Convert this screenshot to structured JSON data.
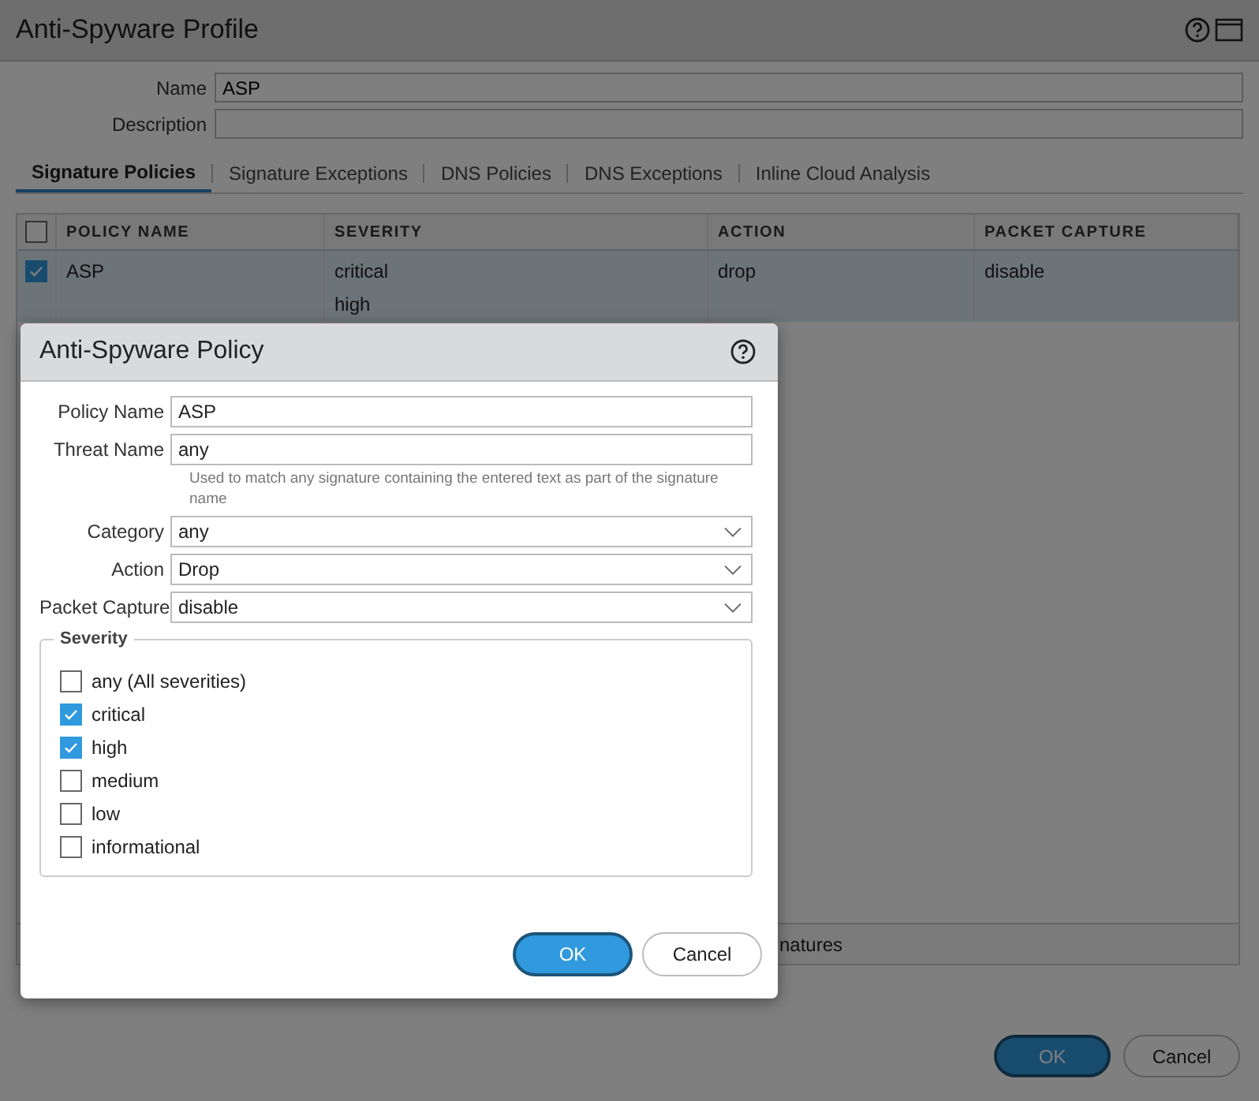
{
  "profile": {
    "title": "Anti-Spyware Profile",
    "fields": [
      {
        "label": "Name",
        "value": "ASP"
      },
      {
        "label": "Description"
      }
    ],
    "tabs": [
      {
        "label": "Signature Policies",
        "selected": true
      },
      {
        "label": "Signature Exceptions",
        "selected": false
      },
      {
        "label": "DNS Policies",
        "selected": false
      },
      {
        "label": "DNS Exceptions",
        "selected": false
      },
      {
        "label": "Inline Cloud Analysis",
        "selected": false
      }
    ],
    "table": {
      "header_checked": false,
      "columns": [
        "POLICY NAME",
        "SEVERITY",
        "ACTION",
        "PACKET CAPTURE"
      ],
      "rows": [
        {
          "checked": true,
          "selected": true,
          "policy_name": "ASP",
          "severity": [
            "critical",
            "high"
          ],
          "action": "drop",
          "packet_capture": "disable"
        }
      ]
    },
    "toolbar_text": "natures",
    "buttons": [
      {
        "label": "OK",
        "kind": "primary"
      },
      {
        "label": "Cancel",
        "kind": "secondary"
      }
    ]
  },
  "dialog": {
    "title": "Anti-Spyware Policy",
    "fields": [
      {
        "label": "Policy Name",
        "kind": "text",
        "value": "ASP"
      },
      {
        "label": "Threat Name",
        "kind": "text",
        "value": "any",
        "help": "Used to match any signature containing the entered text as part of the signature name"
      },
      {
        "label": "Category",
        "kind": "select",
        "value": "any"
      },
      {
        "label": "Action",
        "kind": "select",
        "value": "Drop"
      },
      {
        "label": "Packet Capture",
        "kind": "select",
        "value": "disable"
      }
    ],
    "severity": {
      "legend": "Severity",
      "options": [
        {
          "label": "any (All severities)",
          "checked": false
        },
        {
          "label": "critical",
          "checked": true
        },
        {
          "label": "high",
          "checked": true
        },
        {
          "label": "medium",
          "checked": false
        },
        {
          "label": "low",
          "checked": false
        },
        {
          "label": "informational",
          "checked": false
        }
      ]
    },
    "buttons": [
      {
        "label": "OK",
        "kind": "primary"
      },
      {
        "label": "Cancel",
        "kind": "secondary"
      }
    ]
  }
}
